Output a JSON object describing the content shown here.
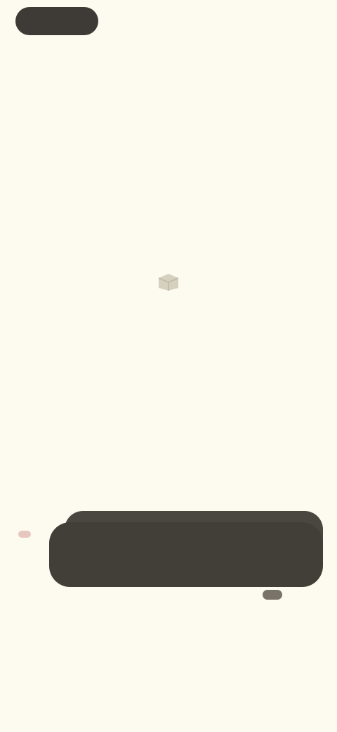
{
  "header": {
    "pill_label": "",
    "sub_label": "",
    "top_right": ""
  },
  "section": {
    "heading": "",
    "subheading": ""
  },
  "empty_state": {
    "icon": "empty-box-icon",
    "title": "",
    "description": ""
  },
  "action_bar": {
    "label": ""
  },
  "nav": {
    "items": [
      "",
      "",
      ""
    ]
  },
  "footer": {
    "links": [
      "",
      ""
    ],
    "end": ""
  },
  "colors": {
    "background": "#fdfbf0",
    "dark": "#423e38",
    "marker": "#e8c6c0"
  }
}
